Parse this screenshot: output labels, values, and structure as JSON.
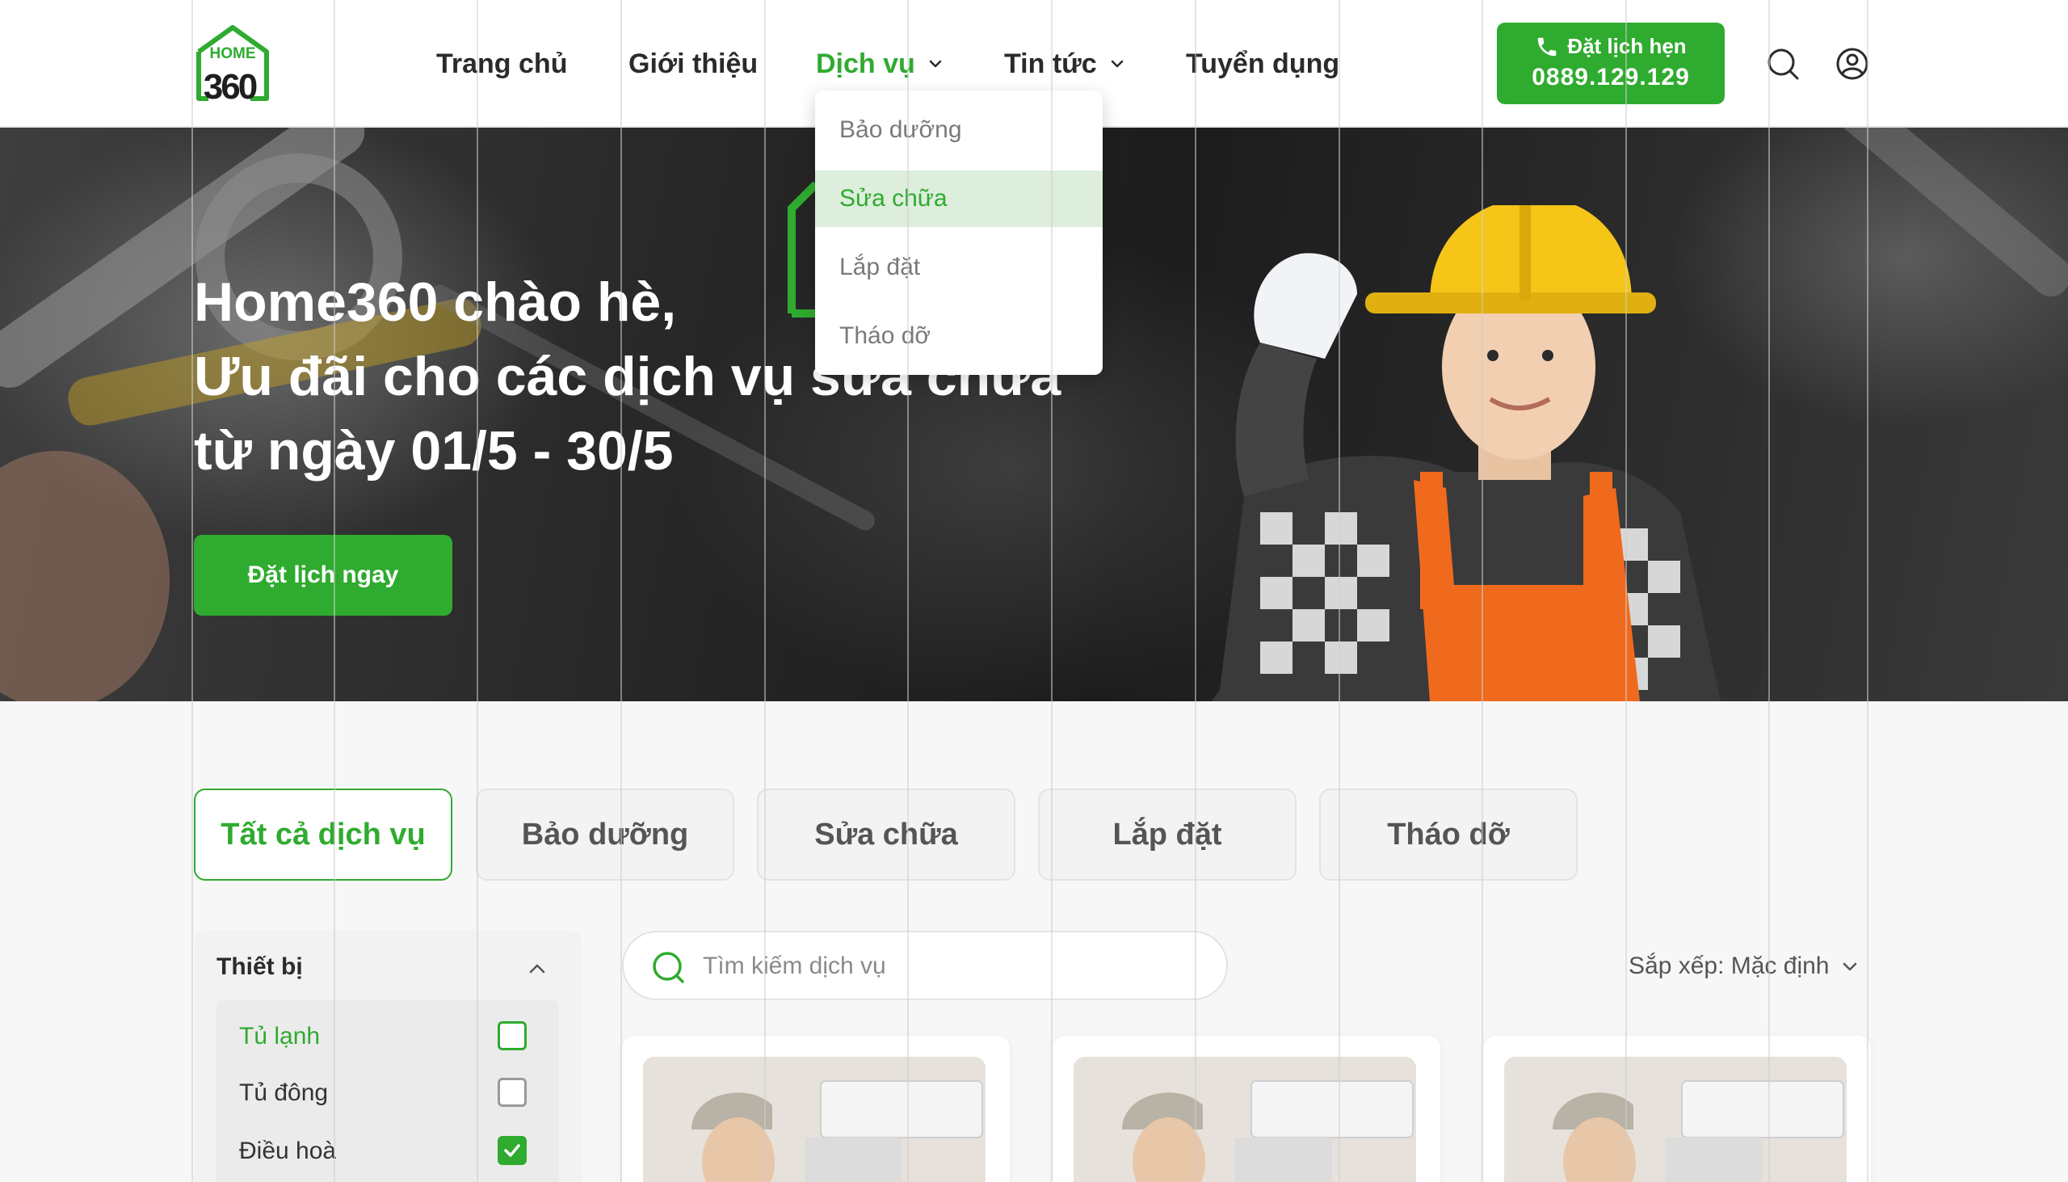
{
  "brand": {
    "logo_text_top": "HOME",
    "logo_text_bottom": "360",
    "accent": "#2fab2f"
  },
  "nav": {
    "items": [
      {
        "label": "Trang chủ"
      },
      {
        "label": "Giới thiệu"
      },
      {
        "label": "Dịch vụ"
      },
      {
        "label": "Tin tức"
      },
      {
        "label": "Tuyển dụng"
      }
    ],
    "active": "Dịch vụ"
  },
  "cta": {
    "label": "Đặt lịch hẹn",
    "phone": "0889.129.129"
  },
  "header_icons": [
    "search-icon",
    "user-icon"
  ],
  "dropdown": {
    "items": [
      {
        "label": "Bảo dưỡng"
      },
      {
        "label": "Sửa chữa"
      },
      {
        "label": "Lắp đặt"
      },
      {
        "label": "Tháo dỡ"
      }
    ],
    "highlighted": "Sửa chữa"
  },
  "hero": {
    "line1": "Home360 chào hè,",
    "line2": "Ưu đãi cho các dịch vụ sửa chữa",
    "line3": "từ ngày 01/5 - 30/5",
    "button": "Đặt lịch ngay"
  },
  "tabs": [
    {
      "label": "Tất cả dịch vụ"
    },
    {
      "label": "Bảo dưỡng"
    },
    {
      "label": "Sửa chữa"
    },
    {
      "label": "Lắp đặt"
    },
    {
      "label": "Tháo dỡ"
    }
  ],
  "active_tab": "Tất cả dịch vụ",
  "filter": {
    "title": "Thiết bị",
    "options": [
      {
        "label": "Tủ lạnh",
        "checked": false
      },
      {
        "label": "Tủ đông",
        "checked": false
      },
      {
        "label": "Điều hoà",
        "checked": true
      }
    ]
  },
  "search": {
    "placeholder": "Tìm kiếm dịch vụ",
    "value": ""
  },
  "sort": {
    "label": "Sắp xếp: Mặc định"
  }
}
